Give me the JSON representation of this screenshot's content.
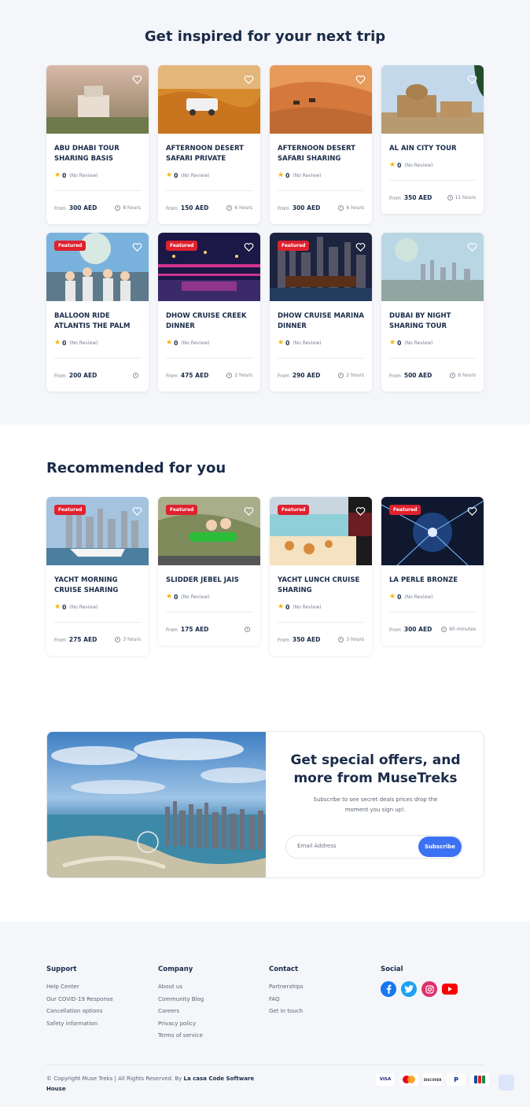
{
  "inspired": {
    "title": "Get inspired for your next trip",
    "cards": [
      {
        "title": "ABU DHABI TOUR SHARING BASIS",
        "featured": false,
        "rating": "0",
        "reviews": "(No Review)",
        "from": "From",
        "price": "300 AED",
        "duration": "8 hours"
      },
      {
        "title": "AFTERNOON DESERT SAFARI PRIVATE",
        "featured": false,
        "rating": "0",
        "reviews": "(No Review)",
        "from": "From",
        "price": "150 AED",
        "duration": "6 hours"
      },
      {
        "title": "AFTERNOON DESERT SAFARI SHARING",
        "featured": false,
        "rating": "0",
        "reviews": "(No Review)",
        "from": "From",
        "price": "300 AED",
        "duration": "6 hours"
      },
      {
        "title": "AL AIN CITY TOUR",
        "featured": false,
        "rating": "0",
        "reviews": "(No Review)",
        "from": "From",
        "price": "350 AED",
        "duration": "11 hours"
      },
      {
        "title": "BALLOON RIDE ATLANTIS THE PALM",
        "featured": true,
        "rating": "0",
        "reviews": "(No Review)",
        "from": "From",
        "price": "200 AED",
        "duration": ""
      },
      {
        "title": "DHOW CRUISE CREEK DINNER",
        "featured": true,
        "rating": "0",
        "reviews": "(No Review)",
        "from": "From",
        "price": "475 AED",
        "duration": "2 hours"
      },
      {
        "title": "DHOW CRUISE MARINA DINNER",
        "featured": true,
        "rating": "0",
        "reviews": "(No Review)",
        "from": "From",
        "price": "290 AED",
        "duration": "2 hours"
      },
      {
        "title": "DUBAI BY NIGHT SHARING TOUR",
        "featured": false,
        "rating": "0",
        "reviews": "(No Review)",
        "from": "From",
        "price": "500 AED",
        "duration": "6 hours"
      }
    ]
  },
  "recommended": {
    "title": "Recommended for you",
    "cards": [
      {
        "title": "YACHT MORNING CRUISE SHARING",
        "featured": true,
        "rating": "0",
        "reviews": "(No Review)",
        "from": "From",
        "price": "275 AED",
        "duration": "3 hours"
      },
      {
        "title": "SLIDDER JEBEL JAIS",
        "featured": true,
        "rating": "0",
        "reviews": "(No Review)",
        "from": "From",
        "price": "175 AED",
        "duration": ""
      },
      {
        "title": "YACHT LUNCH CRUISE SHARING",
        "featured": true,
        "rating": "0",
        "reviews": "(No Review)",
        "from": "From",
        "price": "350 AED",
        "duration": "3 hours"
      },
      {
        "title": "LA PERLE BRONZE",
        "featured": true,
        "rating": "0",
        "reviews": "(No Review)",
        "from": "From",
        "price": "300 AED",
        "duration": "90 minutes"
      }
    ]
  },
  "featured_label": "Featured",
  "newsletter": {
    "title": "Get special offers, and more from MuseTreks",
    "text": "Subscribe to see secret deals prices drop the moment you sign up!.",
    "placeholder": "Email Address",
    "button": "Subscribe"
  },
  "footer": {
    "columns": [
      {
        "title": "Support",
        "links": [
          "Help Center",
          "Our COVID-19 Response",
          "Cancellation options",
          "Safety information"
        ]
      },
      {
        "title": "Company",
        "links": [
          "About us",
          "Community Blog",
          "Careers",
          "Privacy policy",
          "Terms of service"
        ]
      },
      {
        "title": "Contact",
        "links": [
          "Partnerships",
          "FAQ",
          "Get in touch"
        ]
      }
    ],
    "social_title": "Social",
    "social": [
      "facebook-icon",
      "twitter-icon",
      "instagram-icon",
      "youtube-icon"
    ],
    "copyright": "© Copyright Muse Treks | All Rights Reserved. By",
    "company": "La casa Code Software House",
    "payments": [
      "VISA",
      "mastercard",
      "DISCOVER",
      "PayPal",
      "JCB"
    ]
  },
  "colors": {
    "accent": "#3b71f3",
    "featured": "#e0212e",
    "star": "#f7b500",
    "text": "#1a2b49"
  }
}
